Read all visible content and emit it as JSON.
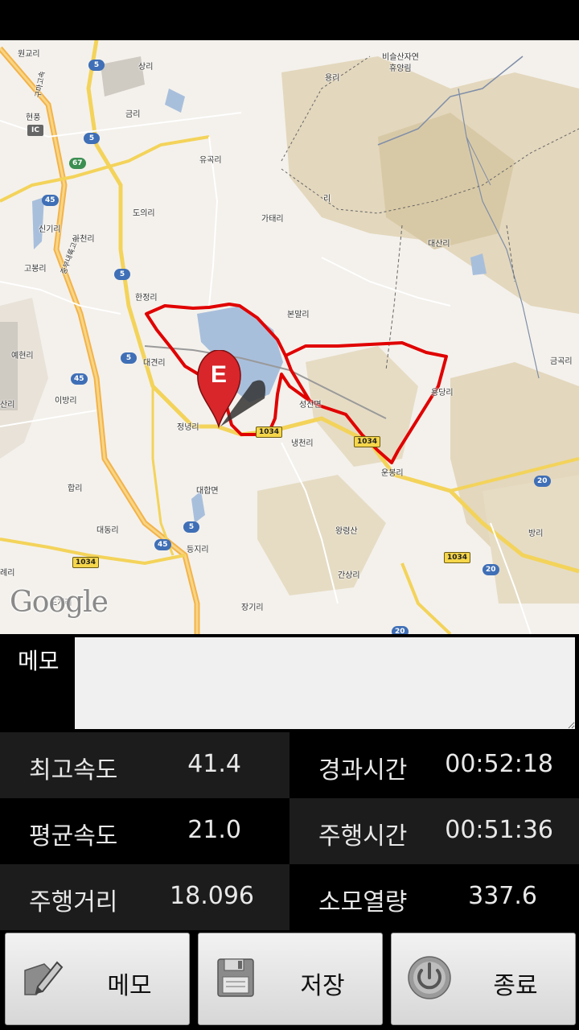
{
  "map": {
    "labels": [
      {
        "text": "원교리"
      },
      {
        "text": "현풍"
      },
      {
        "text": "상리"
      },
      {
        "text": "금리"
      },
      {
        "text": "유곡리"
      },
      {
        "text": "도의리"
      },
      {
        "text": "가태리"
      },
      {
        "text": "용리"
      },
      {
        "text": "비슬산자연"
      },
      {
        "text": "휴양림"
      },
      {
        "text": "대산리"
      },
      {
        "text": "신기리"
      },
      {
        "text": "가천리"
      },
      {
        "text": "고봉리"
      },
      {
        "text": "한정리"
      },
      {
        "text": "본말리"
      },
      {
        "text": "예현리"
      },
      {
        "text": "대견리"
      },
      {
        "text": "이방리"
      },
      {
        "text": "산리"
      },
      {
        "text": "정녕리"
      },
      {
        "text": "냉천리"
      },
      {
        "text": "성산면"
      },
      {
        "text": "용당리"
      },
      {
        "text": "운봉리"
      },
      {
        "text": "금곡리"
      },
      {
        "text": "합리"
      },
      {
        "text": "대합면"
      },
      {
        "text": "대동리"
      },
      {
        "text": "등지리"
      },
      {
        "text": "왕령산"
      },
      {
        "text": "방리"
      },
      {
        "text": "간상리"
      },
      {
        "text": "례리"
      },
      {
        "text": "도개리"
      },
      {
        "text": "장기리"
      },
      {
        "text": "리"
      },
      {
        "text": "중부내륙고속"
      },
      {
        "text": "구마고속"
      },
      {
        "text": "IC"
      }
    ],
    "badges": [
      {
        "text": "5"
      },
      {
        "text": "5"
      },
      {
        "text": "67"
      },
      {
        "text": "45"
      },
      {
        "text": "5"
      },
      {
        "text": "5"
      },
      {
        "text": "45"
      },
      {
        "text": "1034"
      },
      {
        "text": "1034"
      },
      {
        "text": "20"
      },
      {
        "text": "5"
      },
      {
        "text": "45"
      },
      {
        "text": "1034"
      },
      {
        "text": "1034"
      },
      {
        "text": "20"
      },
      {
        "text": "20"
      }
    ],
    "marker_letter": "E",
    "attribution": "Google"
  },
  "memo": {
    "label": "메모",
    "value": ""
  },
  "stats": [
    {
      "label": "최고속도",
      "value": "41.4"
    },
    {
      "label": "경과시간",
      "value": "00:52:18"
    },
    {
      "label": "평균속도",
      "value": "21.0"
    },
    {
      "label": "주행시간",
      "value": "00:51:36"
    },
    {
      "label": "주행거리",
      "value": "18.096"
    },
    {
      "label": "소모열량",
      "value": "337.6"
    }
  ],
  "buttons": [
    {
      "label": "메모",
      "icon": "memo-edit-icon"
    },
    {
      "label": "저장",
      "icon": "floppy-disk-icon"
    },
    {
      "label": "종료",
      "icon": "power-icon"
    }
  ],
  "colors": {
    "route": "#e00000",
    "marker": "#d8262a"
  }
}
